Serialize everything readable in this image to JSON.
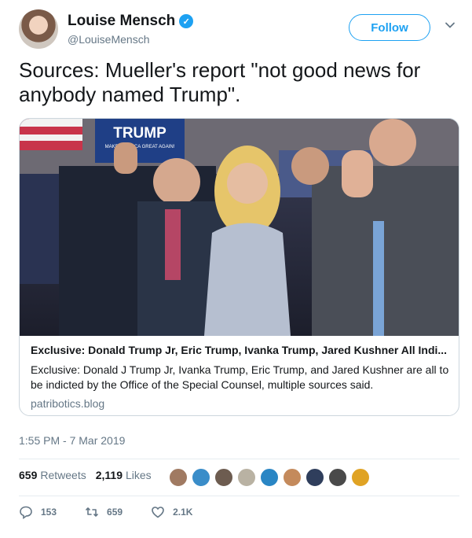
{
  "author": {
    "name": "Louise Mensch",
    "handle": "@LouiseMensch",
    "avatar_icon": "user-avatar",
    "verified_icon": "verified-badge-icon"
  },
  "follow_button": {
    "label": "Follow"
  },
  "tweet": {
    "text": "Sources: Mueller's report \"not good news for anybody named Trump\"."
  },
  "card": {
    "image_sign": {
      "title": "TRUMP",
      "subtitle": "MAKE AMERICA GREAT AGAIN!"
    },
    "title": "Exclusive: Donald Trump Jr, Eric Trump, Ivanka Trump, Jared Kushner All Indi...",
    "description": "Exclusive: Donald J Trump Jr, Ivanka Trump, Eric Trump, and Jared Kushner are all to be indicted by the Office of the Special Counsel, multiple sources said.",
    "domain": "patribotics.blog"
  },
  "timestamp": "1:55 PM - 7 Mar 2019",
  "stats": {
    "retweets_count": "659",
    "retweets_label": "Retweets",
    "likes_count": "2,119",
    "likes_label": "Likes"
  },
  "actions": {
    "replies": "153",
    "retweets": "659",
    "likes": "2.1K"
  },
  "colors": {
    "accent": "#1da1f2",
    "muted": "#657786",
    "text": "#14171a",
    "border": "#ccd6dd"
  }
}
